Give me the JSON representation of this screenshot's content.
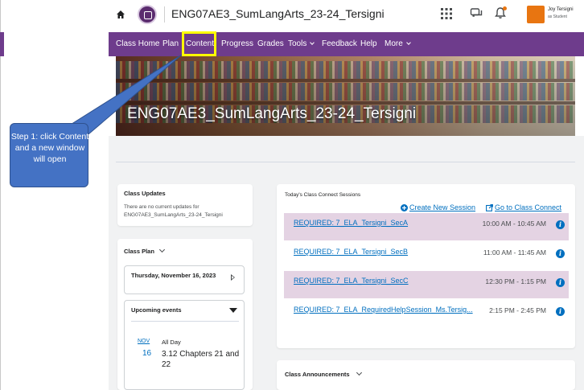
{
  "header": {
    "course_title": "ENG07AE3_SumLangArts_23-24_Tersigni",
    "user_name": "Joy Tersigni",
    "user_role": "as Student",
    "accent": "#6e3c8c",
    "notification_color": "#e87511"
  },
  "nav": {
    "items": [
      "Class Home",
      "Plan",
      "Content",
      "Progress",
      "Grades",
      "Tools",
      "Feedback",
      "Help",
      "More"
    ],
    "highlighted": "Content",
    "highlight_color": "#ffff00"
  },
  "banner": {
    "title": "ENG07AE3_SumLangArts_23-24_Tersigni"
  },
  "callout": {
    "text": "Step 1: click Content and a new window will open",
    "color": "#4472c4"
  },
  "updates": {
    "title": "Class Updates",
    "message": "There are no current updates for ENG07AE3_SumLangArts_23-24_Tersigni"
  },
  "plan": {
    "title": "Class Plan",
    "date": "Thursday, November 16, 2023",
    "events_title": "Upcoming events",
    "event": {
      "month": "NOV",
      "day": "16",
      "time": "All Day",
      "title": "3.12 Chapters 21 and 22"
    }
  },
  "sessions": {
    "title": "Today's Class Connect Sessions",
    "create_label": "Create New Session",
    "goto_label": "Go to Class Connect",
    "rows": [
      {
        "name": "REQUIRED: 7_ELA_Tersigni_SecA",
        "time": "10:00 AM - 10:45 AM",
        "highlighted": true
      },
      {
        "name": "REQUIRED: 7_ELA_Tersigni_SecB",
        "time": "11:00 AM - 11:45 AM",
        "highlighted": false
      },
      {
        "name": "REQUIRED: 7_ELA_Tersigni_SecC",
        "time": "12:30 PM - 1:15 PM",
        "highlighted": true
      },
      {
        "name": "REQUIRED: 7_ELA_RequiredHelpSession_Ms.Tersig...",
        "time": "2:15 PM - 2:45 PM",
        "highlighted": false
      }
    ],
    "highlight_color": "#e4d3e3"
  },
  "announcements": {
    "title": "Class Announcements"
  }
}
